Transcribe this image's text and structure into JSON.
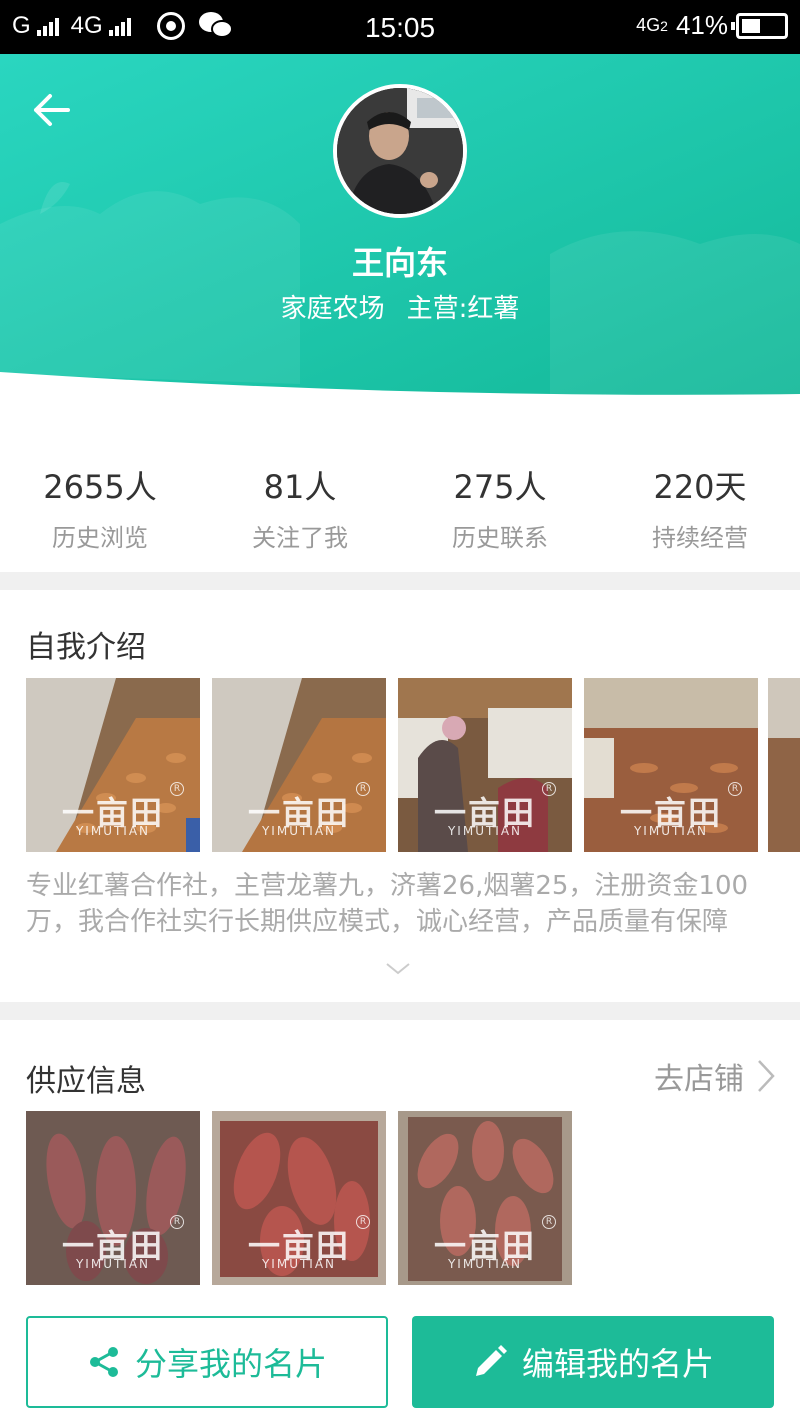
{
  "status_bar": {
    "carrier1": "G",
    "carrier2": "4G",
    "time": "15:05",
    "network": "4G",
    "network_sub": "2",
    "battery": "41%"
  },
  "profile": {
    "name": "王向东",
    "type": "家庭农场",
    "business": "主营:红薯"
  },
  "stats": [
    {
      "value": "2655人",
      "label": "历史浏览"
    },
    {
      "value": "81人",
      "label": "关注了我"
    },
    {
      "value": "275人",
      "label": "历史联系"
    },
    {
      "value": "220天",
      "label": "持续经营"
    }
  ],
  "intro": {
    "title": "自我介绍",
    "text": "专业红薯合作社，主营龙薯九，济薯26,烟薯25，注册资金100万，我合作社实行长期供应模式，诚心经营，产品质量有保障"
  },
  "watermark": {
    "main": "一亩田",
    "sub": "YIMUTIAN",
    "mark": "R"
  },
  "supply": {
    "title": "供应信息",
    "store_link": "去店铺"
  },
  "buttons": {
    "share": "分享我的名片",
    "edit": "编辑我的名片"
  },
  "colors": {
    "primary": "#1dbb98",
    "header_light": "#2ad6c0",
    "header_dark": "#14b999"
  },
  "icons": [
    "back-arrow-icon",
    "share-icon",
    "pencil-icon",
    "chevron-right-icon",
    "chevron-down-icon"
  ]
}
